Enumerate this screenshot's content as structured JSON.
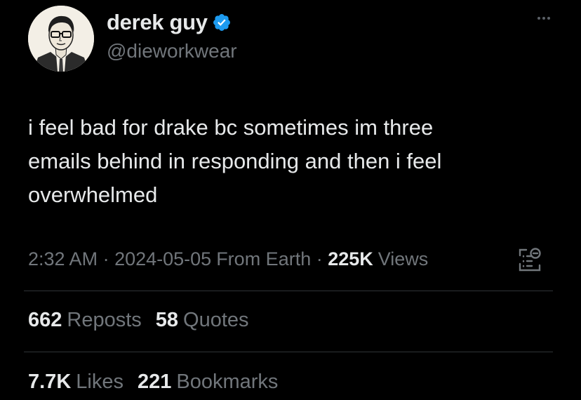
{
  "author": {
    "display_name": "derek guy",
    "handle": "@dieworkwear",
    "verified": true
  },
  "tweet": {
    "text": "i feel bad for drake bc sometimes im three\nemails behind in responding and then i feel\noverwhelmed"
  },
  "meta": {
    "time": "2:32 AM",
    "sep1": " · ",
    "date": "2024-05-05",
    "location": "From Earth",
    "sep2": " · ",
    "views_count": "225K",
    "views_label": "Views"
  },
  "stats": {
    "reposts_count": "662",
    "reposts_label": "Reposts",
    "quotes_count": "58",
    "quotes_label": "Quotes",
    "likes_count": "7.7K",
    "likes_label": "Likes",
    "bookmarks_count": "221",
    "bookmarks_label": "Bookmarks"
  },
  "icons": {
    "verified": "verified-badge-icon",
    "more": "more-options-icon",
    "analytics": "analytics-icon"
  },
  "colors": {
    "background": "#000000",
    "text_primary": "#e7e9ea",
    "text_secondary": "#71767b",
    "verified_blue": "#1d9bf0",
    "divider": "#2f3336"
  }
}
